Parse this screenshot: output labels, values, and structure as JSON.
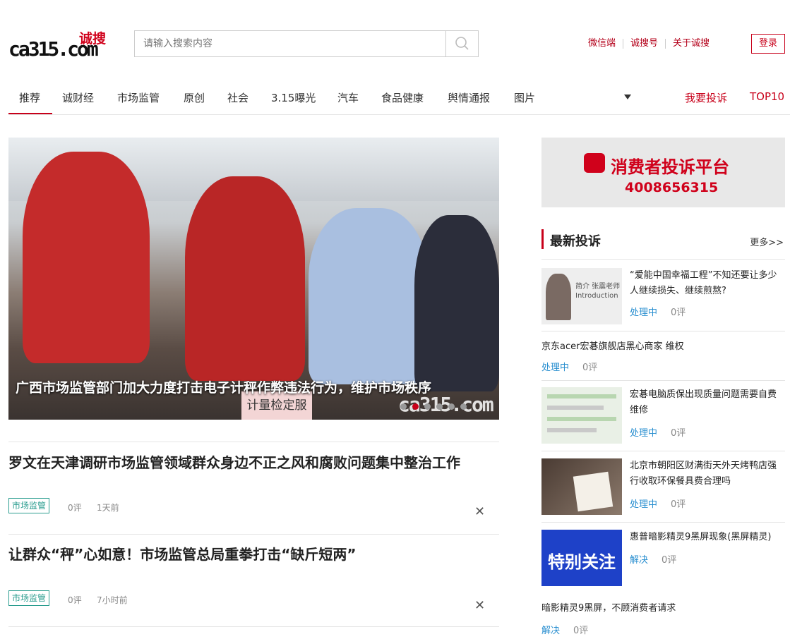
{
  "header": {
    "logo_mark": "ca3",
    "logo_mark2": "15.com",
    "logo_cn": "诚搜",
    "search_placeholder": "请输入搜索内容",
    "links": [
      "微信端",
      "诚搜号",
      "关于诚搜"
    ],
    "login": "登录"
  },
  "nav": {
    "items": [
      "推荐",
      "诚财经",
      "市场监管",
      "原创",
      "社会",
      "3.15曝光",
      "汽车",
      "食品健康",
      "舆情通报",
      "图片"
    ],
    "right": [
      "我要投诉",
      "TOP10"
    ]
  },
  "hero": {
    "caption": "广西市场监管部门加大力度打击电子计秤作弊违法行为，维护市场秩序",
    "sign": "计量检定服务",
    "watermark": "ca315.com",
    "slides": 6,
    "active_slide": 2
  },
  "articles": [
    {
      "title": "罗文在天津调研市场监管领域群众身边不正之风和腐败问题集中整治工作",
      "tag": "市场监管",
      "comments": "0评",
      "time": "1天前"
    },
    {
      "title": "让群众“秤”心如意！市场监管总局重拳打击“缺斤短两”",
      "tag": "市场监管",
      "comments": "0评",
      "time": "7小时前"
    }
  ],
  "ad": {
    "title": "消费者投诉平台",
    "phone": "4008656315"
  },
  "complaints": {
    "title": "最新投诉",
    "more": "更多>>",
    "items": [
      {
        "title": "“爱能中国幸福工程”不知还要让多少人继续损失、继续煎熬?",
        "status": "处理中",
        "comments": "0评",
        "thumb_text": "简介 张震老师 Introduction"
      },
      {
        "title": "京东acer宏碁旗舰店黑心商家 维权",
        "status": "处理中",
        "comments": "0评"
      },
      {
        "title": "宏碁电脑质保出现质量问题需要自费维修",
        "status": "处理中",
        "comments": "0评"
      },
      {
        "title": "北京市朝阳区财满街天外天烤鸭店强行收取环保餐具费合理吗",
        "status": "处理中",
        "comments": "0评"
      },
      {
        "title": "惠普暗影精灵9黑屏现象(黑屏精灵)",
        "status": "解决",
        "comments": "0评",
        "thumb_text": "特别关注"
      },
      {
        "title": "暗影精灵9黑屏，不顾消费者请求",
        "status": "解决",
        "comments": "0评"
      }
    ]
  },
  "colors": {
    "brand_red": "#c8001a",
    "tag_green": "#2a9d8f",
    "status_blue": "#2a8fd0"
  }
}
